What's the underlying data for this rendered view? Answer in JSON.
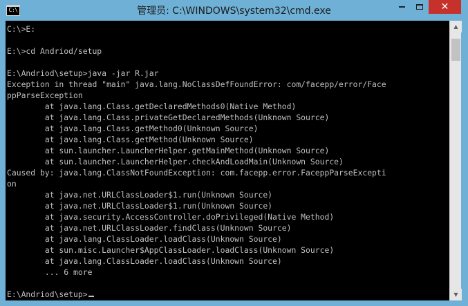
{
  "window": {
    "icon_text": "C:\\",
    "title": "管理员: C:\\WINDOWS\\system32\\cmd.exe",
    "close_glyph": "✕"
  },
  "console": {
    "lines": [
      "C:\\>E:",
      "",
      "E:\\>cd Andriod/setup",
      "",
      "E:\\Andriod\\setup>java -jar R.jar",
      "Exception in thread \"main\" java.lang.NoClassDefFoundError: com/facepp/error/Face",
      "ppParseException",
      "        at java.lang.Class.getDeclaredMethods0(Native Method)",
      "        at java.lang.Class.privateGetDeclaredMethods(Unknown Source)",
      "        at java.lang.Class.getMethod0(Unknown Source)",
      "        at java.lang.Class.getMethod(Unknown Source)",
      "        at sun.launcher.LauncherHelper.getMainMethod(Unknown Source)",
      "        at sun.launcher.LauncherHelper.checkAndLoadMain(Unknown Source)",
      "Caused by: java.lang.ClassNotFoundException: com.facepp.error.FaceppParseExcepti",
      "on",
      "        at java.net.URLClassLoader$1.run(Unknown Source)",
      "        at java.net.URLClassLoader$1.run(Unknown Source)",
      "        at java.security.AccessController.doPrivileged(Native Method)",
      "        at java.net.URLClassLoader.findClass(Unknown Source)",
      "        at java.lang.ClassLoader.loadClass(Unknown Source)",
      "        at sun.misc.Launcher$AppClassLoader.loadClass(Unknown Source)",
      "        at java.lang.ClassLoader.loadClass(Unknown Source)",
      "        ... 6 more",
      "",
      "E:\\Andriod\\setup>"
    ]
  },
  "colors": {
    "titlebar": "#6fb1d6",
    "console_bg": "#000000",
    "console_text": "#c0c0c0",
    "close_button": "#c7312b"
  },
  "icons": {
    "app": "cmd-console-icon",
    "minimize": "minimize-icon",
    "maximize": "maximize-icon",
    "close": "close-icon",
    "scroll_up": "arrow-up-icon",
    "scroll_down": "arrow-down-icon"
  }
}
